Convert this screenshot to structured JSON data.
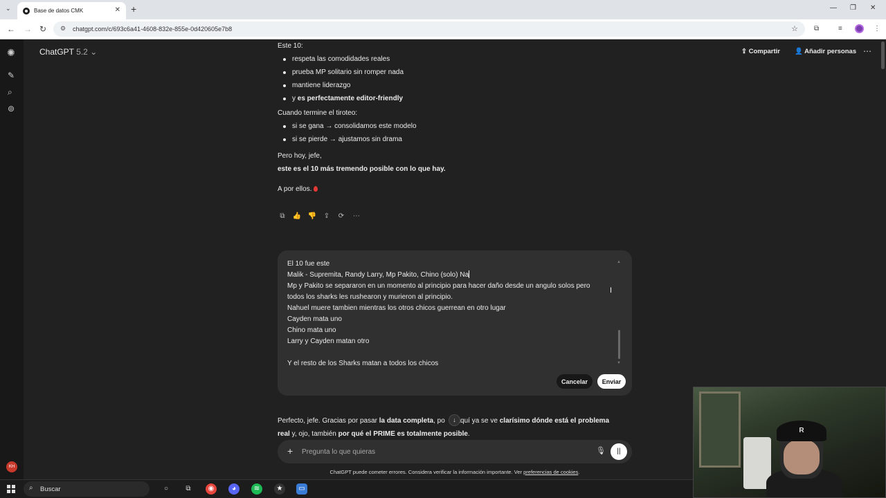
{
  "browser": {
    "tab_title": "Base de datos CMK",
    "url": "chatgpt.com/c/693c6a41-4608-832e-855e-0d420605e7b8"
  },
  "header": {
    "model_name": "ChatGPT",
    "model_version": "5.2",
    "share_label": "Compartir",
    "add_people_label": "Añadir personas"
  },
  "assistant_message": {
    "intro": "Este 10:",
    "bullets1": [
      {
        "plain": "respeta las comodidades reales",
        "bold": ""
      },
      {
        "plain": "prueba MP solitario sin romper nada",
        "bold": ""
      },
      {
        "plain": "mantiene liderazgo",
        "bold": ""
      },
      {
        "plain": "y ",
        "bold": "es perfectamente editor-friendly"
      }
    ],
    "after_heading": "Cuando termine el tiroteo:",
    "bullets2": [
      "si se gana → consolidamos este modelo",
      "si se pierde → ajustamos sin drama"
    ],
    "closing_line1": "Pero hoy, jefe,",
    "closing_line2": "este es el 10 más tremendo posible con lo que hay.",
    "signoff": "A por ellos."
  },
  "actions": {
    "copy_icon": "copy-icon",
    "like_icon": "thumbs-up-icon",
    "dislike_icon": "thumbs-down-icon",
    "share_icon": "share-icon",
    "regenerate_icon": "regenerate-icon",
    "more_icon": "more-icon"
  },
  "edit_box": {
    "lines": [
      "El 10 fue este",
      "Malik - Supremita, Randy Larry, Mp Pakito, Chino (solo) Na",
      "Mp y Pakito se separaron en un momento al principio para hacer daño desde un angulo solos pero",
      "todos los sharks les rushearon y murieron al principio.",
      "Nahuel muere tambien mientras los otros chicos guerrean en otro lugar",
      "Cayden mata uno",
      "Chino mata uno",
      "Larry y Cayden matan otro",
      "",
      "Y el resto de los Sharks matan a todos los chicos"
    ],
    "cancel_label": "Cancelar",
    "send_label": "Enviar"
  },
  "response_preview": {
    "p1": "Perfecto, jefe. Gracias por pasar ",
    "b1": "la data completa",
    "p2": ", po",
    "p3": "e aquí ya se ve ",
    "b2": "clarísimo dónde está el problema",
    "b3": "real",
    "p4": " y, ojo, también ",
    "b4": "por qué el PRIME es totalmente posible",
    "p5": "."
  },
  "composer": {
    "placeholder": "Pregunta lo que quieras"
  },
  "disclaimer": {
    "text": "ChatGPT puede cometer errores. Considera verificar la información importante. Ver ",
    "link": "preferencias de cookies",
    "end": "."
  },
  "user_avatar_initials": "KH",
  "webcam_cap_logo": "R",
  "taskbar": {
    "search_label": "Buscar"
  },
  "colors": {
    "background": "#212121",
    "composer": "#303030",
    "sidebar": "#181818",
    "accent_red": "#e53935"
  }
}
